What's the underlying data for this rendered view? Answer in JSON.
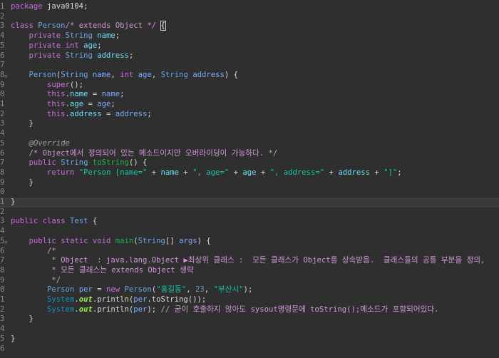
{
  "editor": {
    "lines": [
      {
        "num": "1",
        "tokens": [
          [
            "t-kw",
            "package"
          ],
          [
            "t-plain",
            " java0104;"
          ]
        ]
      },
      {
        "num": "2",
        "tokens": []
      },
      {
        "num": "3",
        "tokens": [
          [
            "t-kw",
            "class"
          ],
          [
            "t-plain",
            " "
          ],
          [
            "t-type",
            "Person"
          ],
          [
            "t-cm",
            "/* extends Object */"
          ],
          [
            "t-plain",
            " "
          ],
          [
            "t-brace",
            "{"
          ]
        ]
      },
      {
        "num": "4",
        "tokens": [
          [
            "t-plain",
            "    "
          ],
          [
            "t-kw",
            "private"
          ],
          [
            "t-plain",
            " "
          ],
          [
            "t-type",
            "String"
          ],
          [
            "t-plain",
            " "
          ],
          [
            "t-field",
            "name"
          ],
          [
            "t-plain",
            ";"
          ]
        ]
      },
      {
        "num": "5",
        "tokens": [
          [
            "t-plain",
            "    "
          ],
          [
            "t-kw",
            "private"
          ],
          [
            "t-plain",
            " "
          ],
          [
            "t-kw",
            "int"
          ],
          [
            "t-plain",
            " "
          ],
          [
            "t-field",
            "age"
          ],
          [
            "t-plain",
            ";"
          ]
        ]
      },
      {
        "num": "6",
        "tokens": [
          [
            "t-plain",
            "    "
          ],
          [
            "t-kw",
            "private"
          ],
          [
            "t-plain",
            " "
          ],
          [
            "t-type",
            "String"
          ],
          [
            "t-plain",
            " "
          ],
          [
            "t-field",
            "address"
          ],
          [
            "t-plain",
            ";"
          ]
        ]
      },
      {
        "num": "7",
        "tokens": []
      },
      {
        "num": "8",
        "fold": true,
        "tokens": [
          [
            "t-plain",
            "    "
          ],
          [
            "t-type",
            "Person"
          ],
          [
            "t-plain",
            "("
          ],
          [
            "t-type",
            "String"
          ],
          [
            "t-plain",
            " "
          ],
          [
            "t-param",
            "name"
          ],
          [
            "t-plain",
            ", "
          ],
          [
            "t-kw",
            "int"
          ],
          [
            "t-plain",
            " "
          ],
          [
            "t-param",
            "age"
          ],
          [
            "t-plain",
            ", "
          ],
          [
            "t-type",
            "String"
          ],
          [
            "t-plain",
            " "
          ],
          [
            "t-param",
            "address"
          ],
          [
            "t-plain",
            ") {"
          ]
        ]
      },
      {
        "num": "9",
        "tokens": [
          [
            "t-plain",
            "        "
          ],
          [
            "t-kw",
            "super"
          ],
          [
            "t-plain",
            "();"
          ]
        ]
      },
      {
        "num": "0",
        "tokens": [
          [
            "t-plain",
            "        "
          ],
          [
            "t-kw",
            "this"
          ],
          [
            "t-plain",
            "."
          ],
          [
            "t-field",
            "name"
          ],
          [
            "t-plain",
            " = "
          ],
          [
            "t-param",
            "name"
          ],
          [
            "t-plain",
            ";"
          ]
        ]
      },
      {
        "num": "1",
        "tokens": [
          [
            "t-plain",
            "        "
          ],
          [
            "t-kw",
            "this"
          ],
          [
            "t-plain",
            "."
          ],
          [
            "t-field",
            "age"
          ],
          [
            "t-plain",
            " = "
          ],
          [
            "t-param",
            "age"
          ],
          [
            "t-plain",
            ";"
          ]
        ]
      },
      {
        "num": "2",
        "tokens": [
          [
            "t-plain",
            "        "
          ],
          [
            "t-kw",
            "this"
          ],
          [
            "t-plain",
            "."
          ],
          [
            "t-field",
            "address"
          ],
          [
            "t-plain",
            " = "
          ],
          [
            "t-param",
            "address"
          ],
          [
            "t-plain",
            ";"
          ]
        ]
      },
      {
        "num": "3",
        "tokens": [
          [
            "t-plain",
            "    }"
          ]
        ]
      },
      {
        "num": "4",
        "tokens": []
      },
      {
        "num": "5",
        "tokens": [
          [
            "t-plain",
            "    "
          ],
          [
            "t-ann",
            "@Override"
          ]
        ]
      },
      {
        "num": "6",
        "tokens": [
          [
            "t-plain",
            "    "
          ],
          [
            "t-cm",
            "/* Object에서 정의되어 있는 메소드이지만 오버라이딩이 가능하다. */"
          ]
        ]
      },
      {
        "num": "7",
        "tokens": [
          [
            "t-plain",
            "    "
          ],
          [
            "t-kw",
            "public"
          ],
          [
            "t-plain",
            " "
          ],
          [
            "t-type",
            "String"
          ],
          [
            "t-plain",
            " "
          ],
          [
            "t-method",
            "toString"
          ],
          [
            "t-plain",
            "() {"
          ]
        ]
      },
      {
        "num": "8",
        "tokens": [
          [
            "t-plain",
            "        "
          ],
          [
            "t-kw",
            "return"
          ],
          [
            "t-plain",
            " "
          ],
          [
            "t-str",
            "\"Person [name=\""
          ],
          [
            "t-plain",
            " + "
          ],
          [
            "t-field",
            "name"
          ],
          [
            "t-plain",
            " + "
          ],
          [
            "t-str",
            "\", age=\""
          ],
          [
            "t-plain",
            " + "
          ],
          [
            "t-field",
            "age"
          ],
          [
            "t-plain",
            " + "
          ],
          [
            "t-str",
            "\", address=\""
          ],
          [
            "t-plain",
            " + "
          ],
          [
            "t-field",
            "address"
          ],
          [
            "t-plain",
            " + "
          ],
          [
            "t-str",
            "\"]\""
          ],
          [
            "t-plain",
            ";"
          ]
        ]
      },
      {
        "num": "9",
        "tokens": [
          [
            "t-plain",
            "    }"
          ]
        ]
      },
      {
        "num": "0",
        "tokens": []
      },
      {
        "num": "1",
        "current": true,
        "tokens": [
          [
            "t-plain",
            "}"
          ]
        ]
      },
      {
        "num": "2",
        "tokens": []
      },
      {
        "num": "3",
        "tokens": [
          [
            "t-kw",
            "public"
          ],
          [
            "t-plain",
            " "
          ],
          [
            "t-kw",
            "class"
          ],
          [
            "t-plain",
            " "
          ],
          [
            "t-type",
            "Test"
          ],
          [
            "t-plain",
            " {"
          ]
        ]
      },
      {
        "num": "4",
        "tokens": []
      },
      {
        "num": "5",
        "fold": true,
        "tokens": [
          [
            "t-plain",
            "    "
          ],
          [
            "t-kw",
            "public"
          ],
          [
            "t-plain",
            " "
          ],
          [
            "t-kw",
            "static"
          ],
          [
            "t-plain",
            " "
          ],
          [
            "t-kw",
            "void"
          ],
          [
            "t-plain",
            " "
          ],
          [
            "t-method",
            "main"
          ],
          [
            "t-plain",
            "("
          ],
          [
            "t-type",
            "String"
          ],
          [
            "t-plain",
            "[] "
          ],
          [
            "t-param",
            "args"
          ],
          [
            "t-plain",
            ") {"
          ]
        ]
      },
      {
        "num": "6",
        "tokens": [
          [
            "t-plain",
            "        "
          ],
          [
            "t-cm",
            "/*"
          ]
        ]
      },
      {
        "num": "7",
        "tokens": [
          [
            "t-plain",
            "        "
          ],
          [
            "t-cm",
            " * Object  : java.lang.Object ▶최상위 클래스 :  모든 클래스가 Object를 상속받음.  클래스들의 공통 부분을 정의,"
          ]
        ]
      },
      {
        "num": "8",
        "tokens": [
          [
            "t-plain",
            "        "
          ],
          [
            "t-cm",
            " * 모든 클래스는 extends Object 생략"
          ]
        ]
      },
      {
        "num": "9",
        "tokens": [
          [
            "t-plain",
            "        "
          ],
          [
            "t-cm",
            " */"
          ]
        ]
      },
      {
        "num": "0",
        "tokens": [
          [
            "t-plain",
            "        "
          ],
          [
            "t-type",
            "Person"
          ],
          [
            "t-plain",
            " "
          ],
          [
            "t-param",
            "per"
          ],
          [
            "t-plain",
            " = "
          ],
          [
            "t-kw",
            "new"
          ],
          [
            "t-plain",
            " "
          ],
          [
            "t-type",
            "Person"
          ],
          [
            "t-plain",
            "("
          ],
          [
            "t-str",
            "\"홍길동\""
          ],
          [
            "t-plain",
            ", "
          ],
          [
            "t-num",
            "23"
          ],
          [
            "t-plain",
            ", "
          ],
          [
            "t-str",
            "\"부산시\""
          ],
          [
            "t-plain",
            ");"
          ]
        ]
      },
      {
        "num": "1",
        "tokens": [
          [
            "t-plain",
            "        "
          ],
          [
            "t-cls",
            "System"
          ],
          [
            "t-plain",
            "."
          ],
          [
            "t-static",
            "out"
          ],
          [
            "t-plain",
            ".println("
          ],
          [
            "t-param",
            "per"
          ],
          [
            "t-plain",
            ".toString());"
          ]
        ]
      },
      {
        "num": "2",
        "tokens": [
          [
            "t-plain",
            "        "
          ],
          [
            "t-cls",
            "System"
          ],
          [
            "t-plain",
            "."
          ],
          [
            "t-static",
            "out"
          ],
          [
            "t-plain",
            ".println("
          ],
          [
            "t-param",
            "per"
          ],
          [
            "t-plain",
            "); "
          ],
          [
            "t-cm",
            "// 굳이 호출하지 않아도 sysout명령문에 toString();메소드가 포함되어있다."
          ]
        ]
      },
      {
        "num": "3",
        "tokens": [
          [
            "t-plain",
            "    }"
          ]
        ]
      },
      {
        "num": "4",
        "tokens": []
      },
      {
        "num": "5",
        "tokens": [
          [
            "t-plain",
            "}"
          ]
        ]
      },
      {
        "num": "6",
        "tokens": []
      }
    ]
  }
}
